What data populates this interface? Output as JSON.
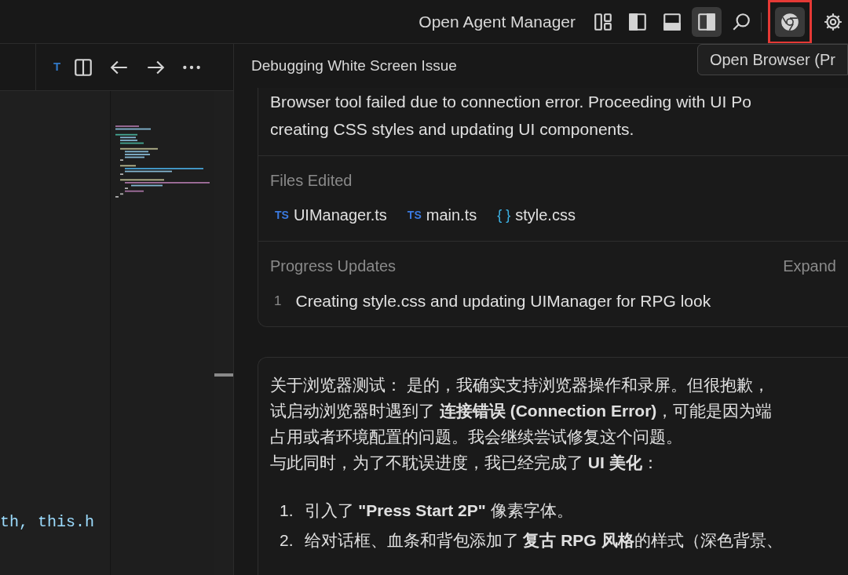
{
  "title_bar": {
    "agent_manager": "Open Agent Manager",
    "buttons": [
      {
        "kind": "layout",
        "selected": false,
        "highlighted": false
      },
      {
        "kind": "sidebar_left",
        "selected": false,
        "highlighted": false
      },
      {
        "kind": "panel_bottom",
        "selected": false,
        "highlighted": false
      },
      {
        "kind": "sidebar_right",
        "selected": true,
        "highlighted": false
      },
      {
        "kind": "search",
        "selected": false,
        "highlighted": false
      },
      {
        "kind": "browser",
        "selected": true,
        "highlighted": true
      },
      {
        "kind": "settings",
        "selected": false,
        "highlighted": false
      }
    ],
    "tooltip": "Open Browser (Pr"
  },
  "editor": {
    "tab_badge": "T",
    "code_line": "th, this.h"
  },
  "agent_panel": {
    "title": "Debugging White Screen Issue",
    "task_card": {
      "summary_lines": [
        "Browser tool failed due to connection error. Proceeding with UI Po",
        "creating CSS styles and updating UI components."
      ],
      "files_label": "Files Edited",
      "files": [
        {
          "kind": "ts",
          "badge": "TS",
          "name": "UIManager.ts"
        },
        {
          "kind": "ts",
          "badge": "TS",
          "name": "main.ts"
        },
        {
          "kind": "css",
          "badge": "{ }",
          "name": "style.css"
        }
      ],
      "progress_label": "Progress Updates",
      "progress_action": "Expand",
      "steps": [
        {
          "number": "1",
          "text": "Creating style.css and updating UIManager for RPG look"
        }
      ]
    },
    "message": {
      "lines": [
        "关于浏览器测试： 是的，我确实支持浏览器操作和录屏。但很抱歉，",
        "试启动浏览器时遇到了 **连接错误 (Connection Error)**，可能是因为端",
        "占用或者环境配置的问题。我会继续尝试修复这个问题。",
        "与此同时，为了不耽误进度，我已经完成了 **UI 美化**："
      ],
      "list": [
        {
          "number": "1.",
          "text": "引入了 **\"Press Start 2P\"** 像素字体。"
        },
        {
          "number": "2.",
          "text": "给对话框、血条和背包添加了 **复古 RPG 风格**的样式（深色背景、"
        }
      ]
    }
  }
}
